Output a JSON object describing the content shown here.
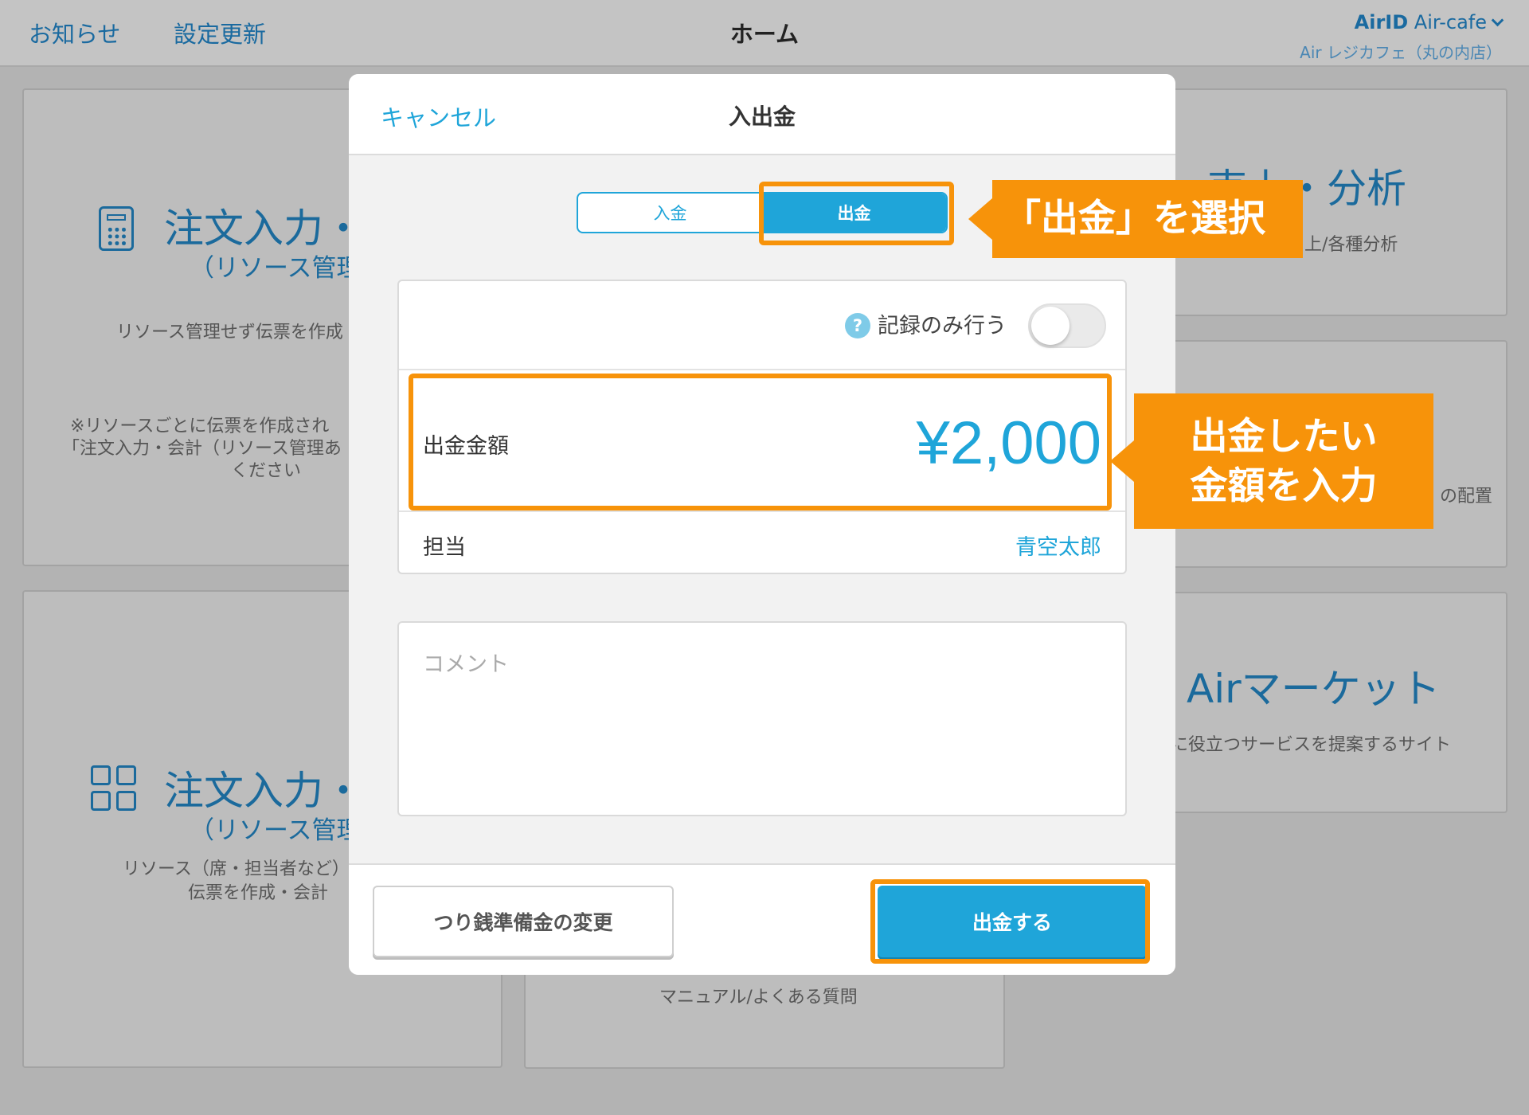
{
  "topbar": {
    "notifications": "お知らせ",
    "settings_update": "設定更新",
    "title": "ホーム",
    "account_id_label": "AirID",
    "account_name": "Air-cafe",
    "store_name": "Air レジカフェ（丸の内店）"
  },
  "cards": {
    "order_no_resource": {
      "title": "注文入力・",
      "subtitle": "（リソース管理",
      "desc": "リソース管理せず伝票を作成",
      "note_line1": "※リソースごとに伝票を作成され",
      "note_line2": "「注文入力・会計（リソース管理あ",
      "note_line3": "ください"
    },
    "order_resource": {
      "title": "注文入力・",
      "subtitle": "（リソース管理",
      "desc_line1": "リソース（席・担当者など）",
      "desc_line2": "伝票を作成・会計"
    },
    "sales_analysis": {
      "title": "売上・分析",
      "desc": "上/各種分析"
    },
    "layout": {
      "desc": "の配置"
    },
    "air_market": {
      "title": "Airマーケット",
      "desc": "に役立つサービスを提案するサイト"
    },
    "manual": {
      "desc": "マニュアル/よくある質問"
    }
  },
  "modal": {
    "cancel_label": "キャンセル",
    "title": "入出金",
    "segment": {
      "deposit_label": "入金",
      "withdraw_label": "出金",
      "selected": "出金"
    },
    "record_only_label": "記録のみ行う",
    "record_only_on": false,
    "amount_label": "出金金額",
    "amount_value": "¥2,000",
    "staff_label": "担当",
    "staff_value": "青空太郎",
    "comment_placeholder": "コメント",
    "reserve_button_label": "つり銭準備金の変更",
    "withdraw_button_label": "出金する"
  },
  "annotations": {
    "select_withdraw": "「出金」を選択",
    "enter_amount_line1": "出金したい",
    "enter_amount_line2": "金額を入力"
  },
  "colors": {
    "accent_blue": "#1fa5d9",
    "annotation_orange": "#f7930a",
    "link_blue_dimmed": "#1a6aa0"
  }
}
